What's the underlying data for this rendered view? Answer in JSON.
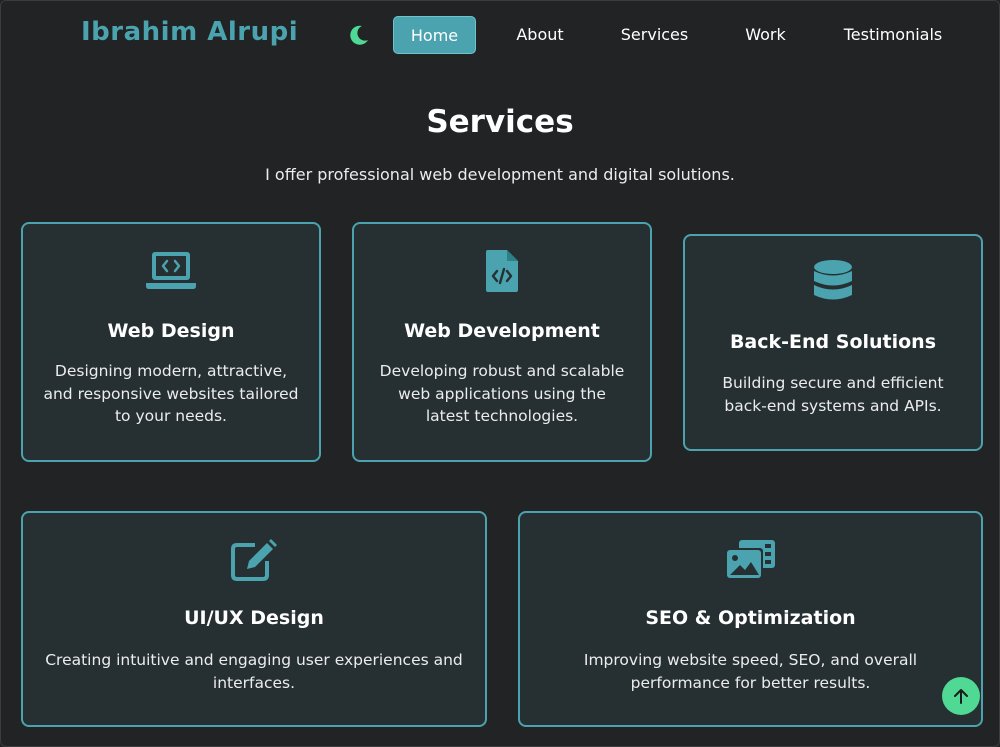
{
  "header": {
    "brand": "Ibrahim Alrupi",
    "theme_toggle_icon": "moon-icon",
    "nav": [
      {
        "label": "Home",
        "active": true
      },
      {
        "label": "About",
        "active": false
      },
      {
        "label": "Services",
        "active": false
      },
      {
        "label": "Work",
        "active": false
      },
      {
        "label": "Testimonials",
        "active": false
      }
    ]
  },
  "section": {
    "title": "Services",
    "subtitle": "I offer professional web development and digital solutions."
  },
  "services": [
    {
      "icon": "laptop-code-icon",
      "title": "Web Design",
      "description": "Designing modern, attractive, and responsive websites tailored to your needs."
    },
    {
      "icon": "file-code-icon",
      "title": "Web Development",
      "description": "Developing robust and scalable web applications using the latest technologies."
    },
    {
      "icon": "database-icon",
      "title": "Back-End Solutions",
      "description": "Building secure and efficient back-end systems and APIs."
    },
    {
      "icon": "edit-icon",
      "title": "UI/UX Design",
      "description": "Creating intuitive and engaging user experiences and interfaces."
    },
    {
      "icon": "photo-film-icon",
      "title": "SEO & Optimization",
      "description": "Improving website speed, SEO, and overall performance for better results."
    }
  ],
  "back_to_top_icon": "arrow-up-icon",
  "colors": {
    "accent": "#4aa3ae",
    "background": "#222324",
    "card_background": "#263033",
    "back_to_top": "#4fd995",
    "moon": "#4fd995"
  }
}
